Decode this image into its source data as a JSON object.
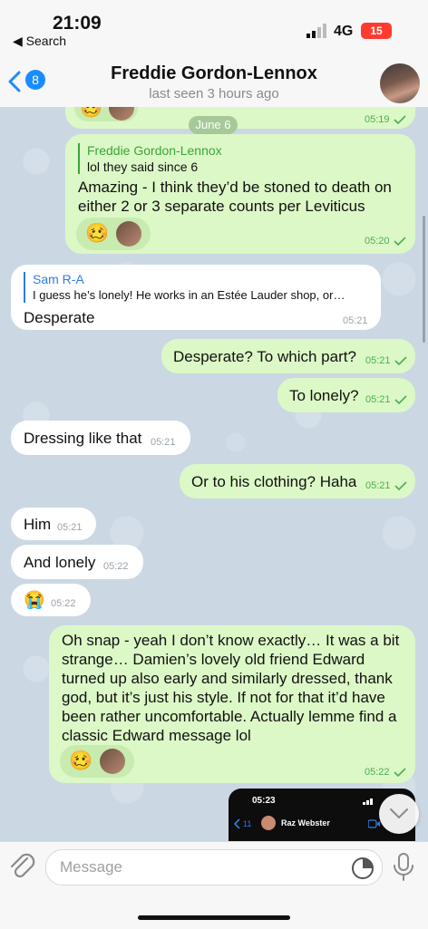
{
  "status": {
    "time": "21:09",
    "back_app": "◀ Search",
    "network": "4G",
    "battery": "15"
  },
  "header": {
    "back_count": "8",
    "name": "Freddie Gordon-Lennox",
    "subtitle": "last seen 3 hours ago"
  },
  "date_divider": "June 6",
  "messages": {
    "m0": {
      "time": "05:19"
    },
    "m1": {
      "reply_name": "Freddie Gordon-Lennox",
      "reply_text": "lol they said since 6",
      "text": "Amazing - I think they’d be stoned to death on either 2 or 3 separate counts per Leviticus",
      "time": "05:20"
    },
    "m2": {
      "reply_name": "Sam R-A",
      "reply_text": "I guess he’s lonely! He works in an Estée Lauder shop, or…",
      "text": "Desperate",
      "time": "05:21"
    },
    "m3": {
      "text": "Desperate? To which part?",
      "time": "05:21"
    },
    "m4": {
      "text": "To lonely?",
      "time": "05:21"
    },
    "m5": {
      "text": "Dressing like that",
      "time": "05:21"
    },
    "m6": {
      "text": "Or to his clothing? Haha",
      "time": "05:21"
    },
    "m7": {
      "text": "Him",
      "time": "05:21"
    },
    "m8": {
      "text": "And lonely",
      "time": "05:22"
    },
    "m9": {
      "emoji": "😭",
      "time": "05:22"
    },
    "m10": {
      "text": "Oh snap - yeah I don’t know exactly… It was a bit strange… Damien’s lovely old friend Edward turned up also early and similarly dressed, thank god, but it’s just his style. If not for that it’d have been rather uncomfortable. Actually lemme find a classic Edward message lol",
      "time": "05:22"
    },
    "m11": {
      "shot_time": "05:23",
      "shot_back": "11",
      "shot_name": "Raz Webster"
    }
  },
  "reaction_emoji": "🥴",
  "input": {
    "placeholder": "Message"
  },
  "colors": {
    "accent": "#1a8cff",
    "reply_green": "#3aa53a",
    "reply_blue": "#2f7de0",
    "out_bubble": "#dcf8c6",
    "battery": "#ff3b30"
  }
}
